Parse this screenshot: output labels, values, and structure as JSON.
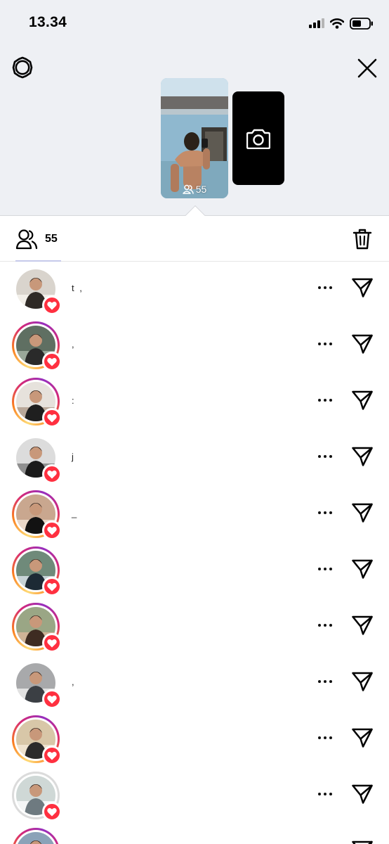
{
  "status_bar": {
    "time": "13.34"
  },
  "story": {
    "viewer_count": "55"
  },
  "viewers_tab": {
    "count": "55"
  },
  "colors": {
    "like": "#ff3040",
    "tab_indicator": "#c5c9ea",
    "header_bg": "#eef0f4"
  },
  "viewers": [
    {
      "username": "t ,",
      "ring": "none",
      "liked": true
    },
    {
      "username": ",",
      "ring": "story",
      "liked": true
    },
    {
      "username": ":",
      "ring": "story",
      "liked": true
    },
    {
      "username": "j",
      "ring": "none",
      "liked": true
    },
    {
      "username": "_",
      "ring": "story",
      "liked": true
    },
    {
      "username": "",
      "ring": "story",
      "liked": true
    },
    {
      "username": "",
      "ring": "story",
      "liked": true
    },
    {
      "username": ",",
      "ring": "none",
      "liked": true
    },
    {
      "username": "",
      "ring": "story",
      "liked": true
    },
    {
      "username": "",
      "ring": "seen",
      "liked": true
    },
    {
      "username": "",
      "ring": "story",
      "liked": false
    }
  ]
}
